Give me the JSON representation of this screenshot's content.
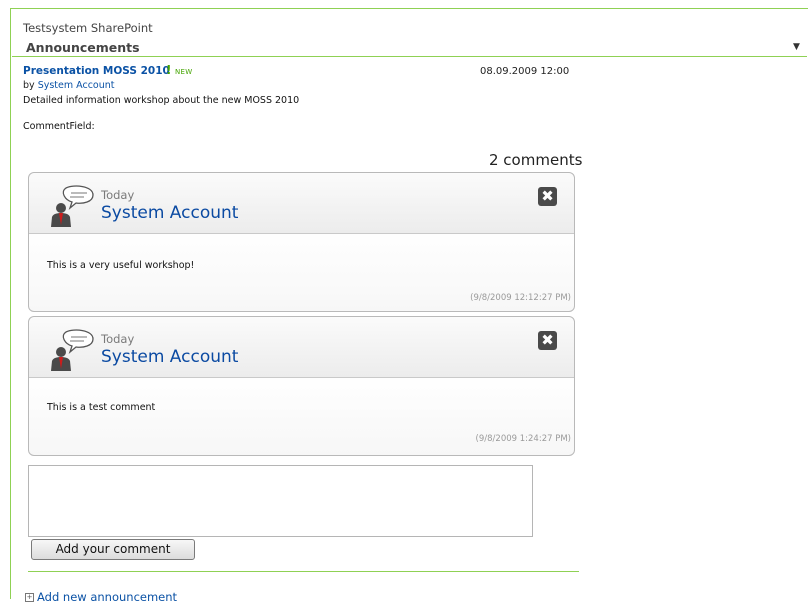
{
  "site": {
    "title": "Testsystem SharePoint"
  },
  "webpart": {
    "title": "Announcements",
    "menu_icon": "dropdown-arrow"
  },
  "announcement": {
    "title": "Presentation MOSS 2010",
    "new_mark": "!",
    "new_label": "NEW",
    "date": "08.09.2009 12:00",
    "by_prefix": "by",
    "author": "System Account",
    "body": "Detailed information workshop about the new MOSS 2010",
    "comment_field_label": "CommentField:"
  },
  "comments": {
    "count_label": "2 comments",
    "items": [
      {
        "when": "Today",
        "author": "System Account",
        "text": "This is a very useful workshop!",
        "timestamp": "(9/8/2009 12:12:27 PM)",
        "close_icon": "close-icon"
      },
      {
        "when": "Today",
        "author": "System Account",
        "text": "This is a test comment",
        "timestamp": "(9/8/2009 1:24:27 PM)",
        "close_icon": "close-icon"
      }
    ]
  },
  "comment_form": {
    "value": "",
    "submit_label": "Add your comment"
  },
  "footer": {
    "add_label": "Add new announcement"
  },
  "colors": {
    "accent_green": "#8fd154",
    "link_blue": "#0b52a5",
    "new_green": "#43a400"
  }
}
